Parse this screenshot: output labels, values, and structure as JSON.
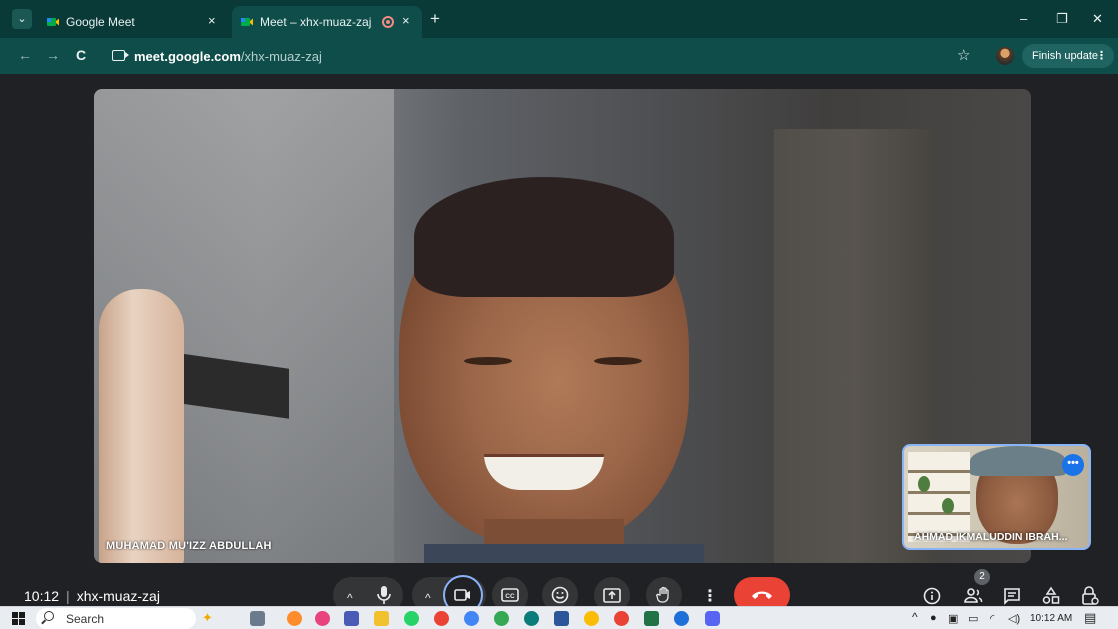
{
  "browser": {
    "tabs": [
      {
        "title": "Google Meet",
        "close_label": "×"
      },
      {
        "title": "Meet – xhx-muaz-zaj",
        "close_label": "×"
      }
    ],
    "new_tab_label": "+",
    "window_controls": {
      "minimize": "–",
      "restore": "❐",
      "close": "✕"
    },
    "address": {
      "host": "meet.google.com",
      "path": "/xhx-muaz-zaj"
    },
    "nav": {
      "back": "←",
      "forward": "→",
      "reload": "C"
    },
    "bookmark_icon": "☆",
    "finish_update_label": "Finish update",
    "menu_label": "⋮"
  },
  "meeting": {
    "main_participant": "MUHAMAD MU'IZZ ABDULLAH",
    "pip_participant": "AHMAD IKMALUDDIN IBRAH...",
    "time": "10:12",
    "separator": "|",
    "code": "xhx-muaz-zaj",
    "participant_count": "2",
    "pip_more_label": "•••"
  },
  "controls": {
    "mic_caret": "^",
    "cam_caret": "^",
    "mic_icon": "microphone-icon",
    "cam_icon": "camera-icon",
    "captions_icon": "captions-icon",
    "emoji_icon": "emoji-icon",
    "present_icon": "present-icon",
    "hand_icon": "raise-hand-icon",
    "more_icon": "⋮",
    "end_icon": "end-call-icon"
  },
  "taskbar": {
    "search_placeholder": "Search",
    "tray_time": "10:12 AM",
    "tray_chevron": "^"
  },
  "colors": {
    "tab_strip": "#0a3a37",
    "toolbar": "#0e4d4a",
    "stage": "#202124",
    "end_call": "#ea4335",
    "camera_ring": "#8ab4f8",
    "pip_border": "#8ab4f8"
  }
}
